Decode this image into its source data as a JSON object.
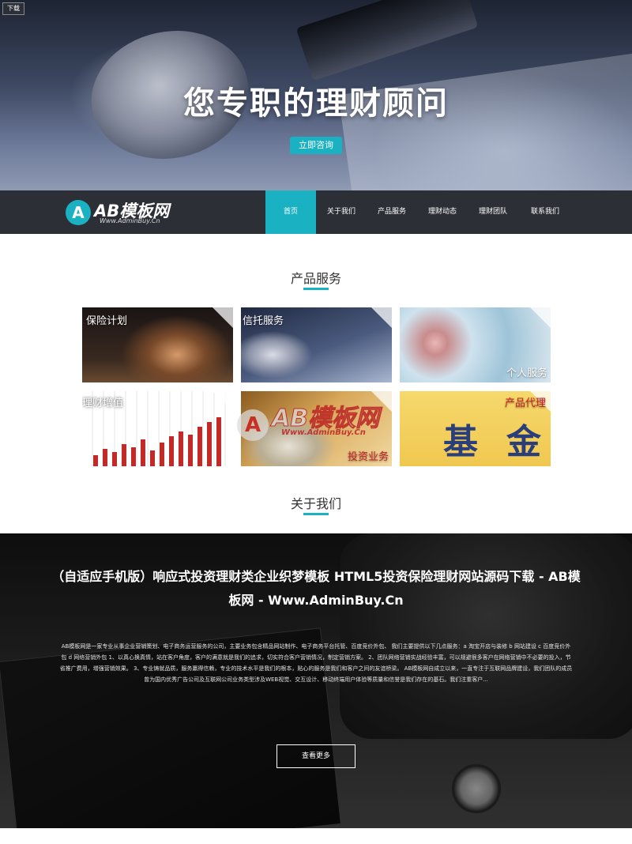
{
  "hero": {
    "top_tag": "下载",
    "title": "您专职的理财顾问",
    "cta": "立即咨询"
  },
  "logo": {
    "mark": "A",
    "name": "AB模板网",
    "url": "Www.AdminBuy.Cn"
  },
  "nav": {
    "items": [
      {
        "label": "首页",
        "active": true
      },
      {
        "label": "关于我们"
      },
      {
        "label": "产品服务"
      },
      {
        "label": "理财动态"
      },
      {
        "label": "理财团队"
      },
      {
        "label": "联系我们"
      }
    ]
  },
  "products": {
    "title": "产品服务",
    "tiles": [
      {
        "label": "保险计划"
      },
      {
        "label": "信托服务"
      },
      {
        "label": "个人服务"
      },
      {
        "label": "理财增值"
      },
      {
        "label": "投资业务"
      },
      {
        "label": "产品代理",
        "big_text": [
          "基",
          "金"
        ]
      }
    ]
  },
  "watermark": {
    "mark": "A",
    "name": "AB模板网",
    "url": "Www.AdminBuy.Cn"
  },
  "about": {
    "section_title": "关于我们",
    "headline": "（自适应手机版）响应式投资理财类企业织梦模板 HTML5投资保险理财网站源码下载 - AB模板网 - Www.AdminBuy.Cn",
    "body": "AB模板网是一家专业从事企业营销策划、电子商务运营服务的公司，主要业务包含精品网站制作、电子商务平台托管、百度竞价外包、 我们主要提供以下几点服务：a 淘宝开店与装修 b 网站建设 c 百度竞价外包 d 网络营销外包 1、以真心换真情，站在客户角度，客户的满意就是我们的追求，切实符合客户营销情况，制定营销方案。 2、团队网络营销实战经验丰富，可以规避很多客户在网络营销中不必要的投入，节省推广费用，增强营销效果。 3、专业铸就品质，服务赢得信赖，专业的技术水平是我们的根本，贴心的服务是我们和客户之间的友谊桥梁。 AB模板网自成立以来，一直专注于互联网品牌建设，我们团队的成员曾为国内优秀广告公司及互联网公司业务类型涉及WEB视觉、交互设计、移动终端用户体验等质量和信誉是我们存在的基石。我们注重客户...",
    "more": "查看更多"
  }
}
